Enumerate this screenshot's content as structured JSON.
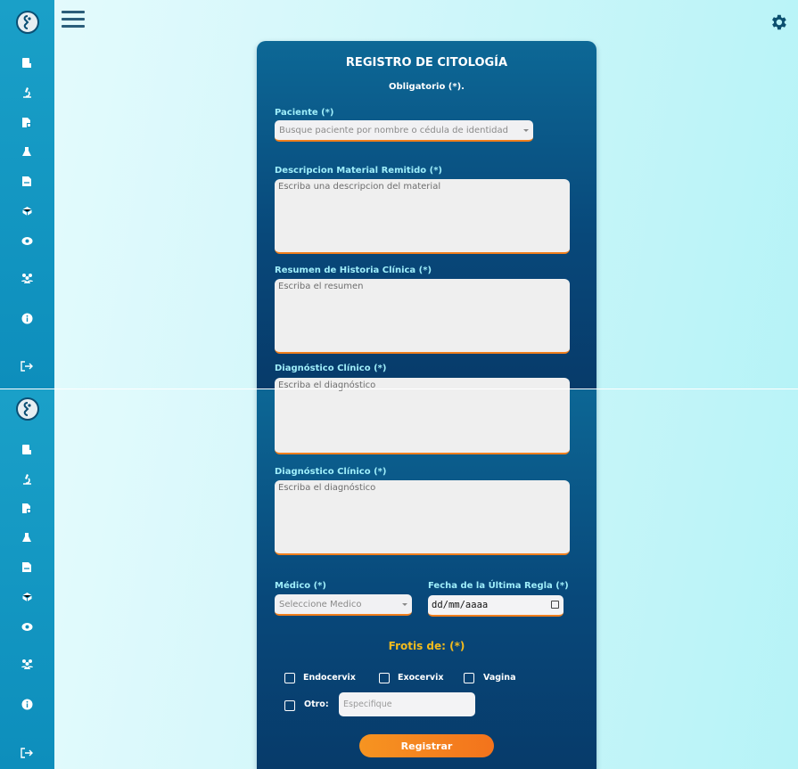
{
  "app": {
    "sidebar_icons": [
      "logo-icon",
      "patient-icon",
      "microscope-icon",
      "document-icon",
      "flask-icon",
      "report-icon",
      "organ-icon",
      "eye-icon",
      "users-icon",
      "info-icon",
      "logout-icon"
    ],
    "accent_color": "#f3731c",
    "sidebar_color": "#1596c4"
  },
  "form": {
    "title": "REGISTRO DE CITOLOGÍA",
    "subtitle": "Obligatorio (*).",
    "paciente": {
      "label": "Paciente (*)",
      "placeholder": "Busque paciente por nombre o cédula de identidad"
    },
    "descripcion": {
      "label": "Descripcion Material Remitido (*)",
      "placeholder": "Escriba una descripcion del material"
    },
    "resumen": {
      "label": "Resumen de Historia Clínica (*)",
      "placeholder": "Escriba el resumen"
    },
    "diagnostico": {
      "label": "Diagnóstico Clínico (*)",
      "placeholder": "Escriba el diagnóstico"
    },
    "medico": {
      "label": "Médico (*)",
      "placeholder": "Seleccione Medico"
    },
    "fecha": {
      "label": "Fecha de la Última Regla (*)",
      "value": "dd/mm/aaaa"
    },
    "frotis": {
      "label": "Frotis de: (*)",
      "options": [
        "Endocervix",
        "Exocervix",
        "Vagina"
      ],
      "otro_label": "Otro:",
      "otro_placeholder": "Especifique"
    },
    "submit_label": "Registrar"
  }
}
